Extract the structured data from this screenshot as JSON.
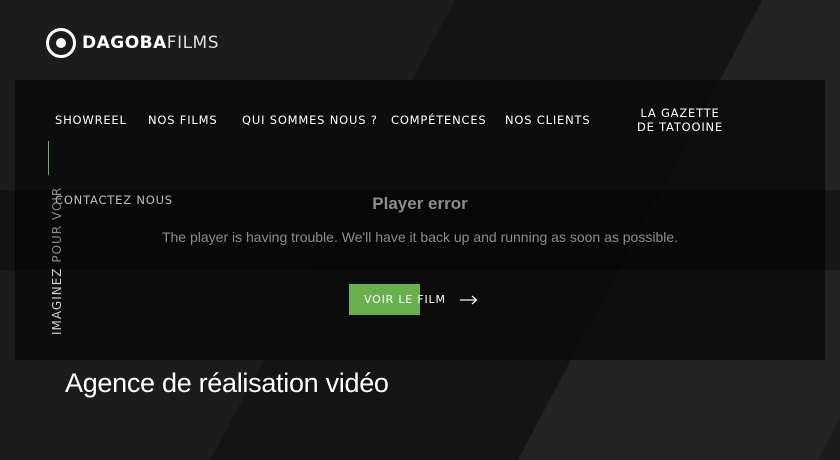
{
  "brand": {
    "name_bold": "DAGOBA",
    "name_light": "FILMS"
  },
  "nav": {
    "items": [
      {
        "label": "SHOWREEL"
      },
      {
        "label": "NOS FILMS"
      },
      {
        "label": "QUI SOMMES NOUS ?"
      },
      {
        "label": "COMPÉTENCES"
      },
      {
        "label": "NOS CLIENTS"
      },
      {
        "label": "LA GAZETTE DE TATOOINE"
      },
      {
        "label": "CONTACTEZ NOUS"
      }
    ]
  },
  "side": {
    "part1": "IMAGINEZ",
    "part2": " POUR VOIR"
  },
  "player": {
    "title": "Player error",
    "message": "The player is having trouble. We'll have it back up and running as soon as possible."
  },
  "cta": {
    "label": "VOIR LE FILM"
  },
  "hero": {
    "headline": "Agence de réalisation vidéo"
  },
  "colors": {
    "accent": "#6ab04c",
    "panel": "#0a0a0a",
    "background": "#1c1c1c"
  }
}
